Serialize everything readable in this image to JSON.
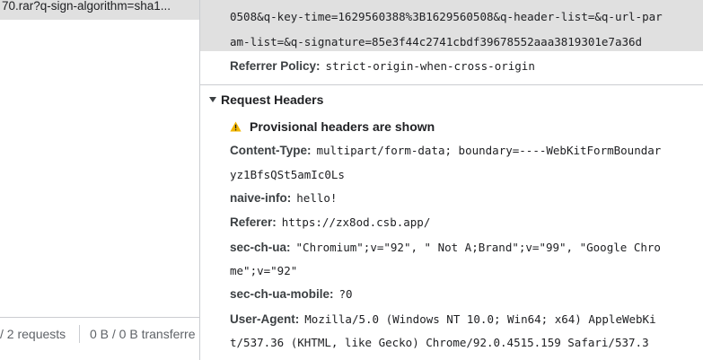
{
  "request_list": {
    "selected_request": "70.rar?q-sign-algorithm=sha1..."
  },
  "status_bar": {
    "requests": "/ 2 requests",
    "transferred": "0 B / 0 B transferre"
  },
  "general": {
    "url_lines": [
      "0508&q-key-time=1629560388%3B1629560508&q-header-list=&q-url-par",
      "am-list=&q-signature=85e3f44c2741cbdf39678552aaa3819301e7a36d"
    ],
    "referrer_policy_label": "Referrer Policy:",
    "referrer_policy_value": "strict-origin-when-cross-origin"
  },
  "request_headers": {
    "title": "Request Headers",
    "provisional_text": "Provisional headers are shown",
    "headers": {
      "content_type": {
        "key": "Content-Type:",
        "value": "multipart/form-data; boundary=----WebKitFormBoundar",
        "continuation": "yz1BfsQSt5amIc0Ls"
      },
      "naive_info": {
        "key": "naive-info:",
        "value": "hello!"
      },
      "referer": {
        "key": "Referer:",
        "value": "https://zx8od.csb.app/"
      },
      "sec_ch_ua": {
        "key": "sec-ch-ua:",
        "value": "\"Chromium\";v=\"92\", \" Not A;Brand\";v=\"99\", \"Google Chro",
        "continuation": "me\";v=\"92\""
      },
      "sec_ch_ua_mobile": {
        "key": "sec-ch-ua-mobile:",
        "value": "?0"
      },
      "user_agent": {
        "key": "User-Agent:",
        "value": "Mozilla/5.0 (Windows NT 10.0; Win64; x64) AppleWebKi",
        "continuation": "t/537.36 (KHTML, like Gecko) Chrome/92.0.4515.159 Safari/537.3"
      }
    }
  },
  "colors": {
    "selected_row_bg": "#e0e0e0",
    "warning_icon": "#f2b600",
    "key_text": "#3c4043",
    "border": "#cbcdd1"
  }
}
